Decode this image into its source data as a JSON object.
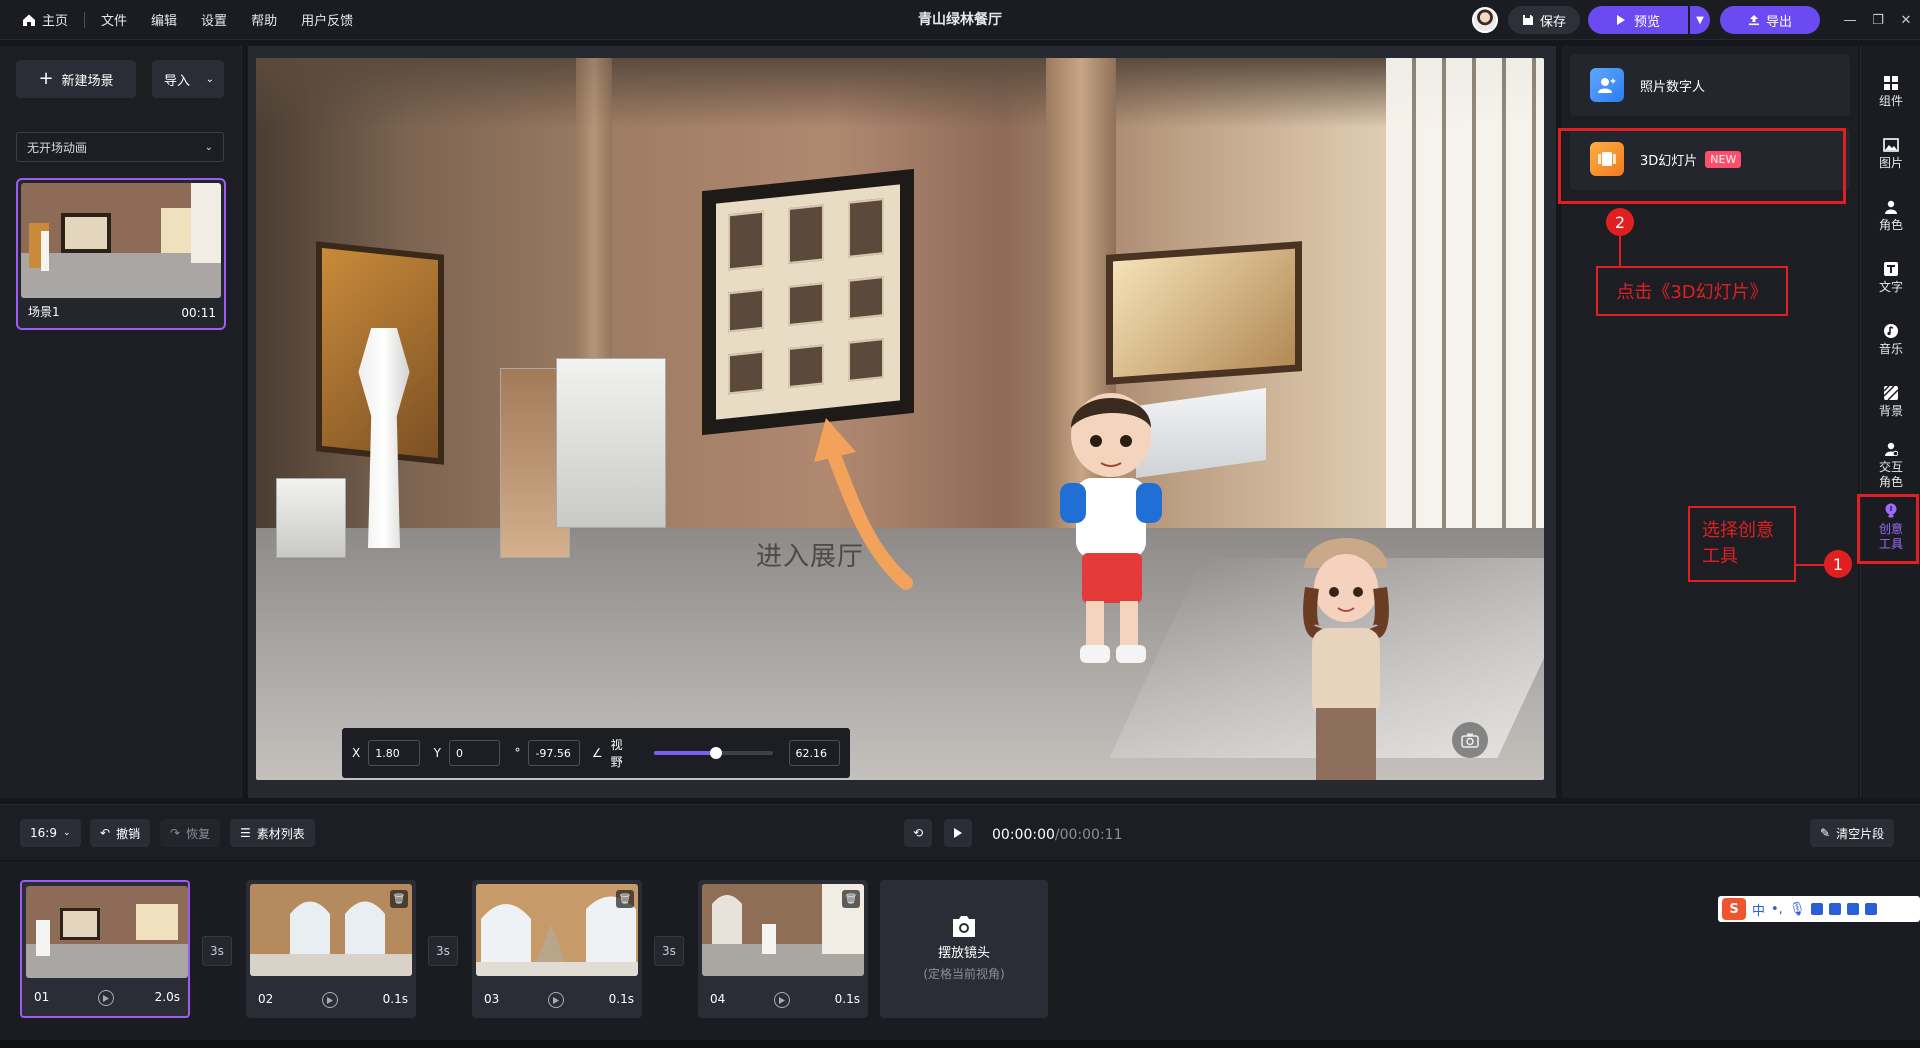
{
  "topbar": {
    "menu": [
      "主页",
      "文件",
      "编辑",
      "设置",
      "帮助",
      "用户反馈"
    ],
    "title": "青山绿林餐厅",
    "save": "保存",
    "preview": "预览",
    "export": "导出"
  },
  "left": {
    "new_scene": "新建场景",
    "import": "导入",
    "transition": "无开场动画",
    "scene": {
      "name": "场景1",
      "duration": "00:11"
    }
  },
  "stage": {
    "caption": "进入展厅",
    "camera": {
      "x_label": "X",
      "x": "1.80",
      "y_label": "Y",
      "y": "0",
      "rot_label": "°",
      "rot": "-97.56",
      "fov_label": "视野",
      "fov": "62.16",
      "fov_level": 0.52
    }
  },
  "tools": {
    "photo_avatar": "照片数字人",
    "slides_3d": "3D幻灯片",
    "new_badge": "NEW"
  },
  "rail": [
    {
      "label": "组件",
      "icon": "grid-icon"
    },
    {
      "label": "图片",
      "icon": "image-icon"
    },
    {
      "label": "角色",
      "icon": "person-icon"
    },
    {
      "label": "文字",
      "icon": "text-icon"
    },
    {
      "label": "音乐",
      "icon": "music-icon"
    },
    {
      "label": "背景",
      "icon": "background-icon"
    },
    {
      "label": "交互角色",
      "icon": "interactive-person-icon"
    },
    {
      "label": "创意工具",
      "icon": "idea-icon"
    }
  ],
  "annotations": {
    "step1_num": "1",
    "step1_text": "选择创意工具",
    "step2_num": "2",
    "step2_text": "点击《3D幻灯片》",
    "color": "#e02020"
  },
  "toolbar": {
    "ratio": "16:9",
    "undo": "撤销",
    "redo": "恢复",
    "assets": "素材列表",
    "time_current": "00:00:00",
    "time_total": "/00:00:11",
    "clear": "清空片段"
  },
  "timeline": {
    "clips": [
      {
        "num": "01",
        "dur": "2.0s"
      },
      {
        "num": "02",
        "dur": "0.1s"
      },
      {
        "num": "03",
        "dur": "0.1s"
      },
      {
        "num": "04",
        "dur": "0.1s"
      }
    ],
    "transitions": [
      "3s",
      "3s",
      "3s"
    ],
    "add_camera": "摆放镜头",
    "add_camera_hint": "(定格当前视角)"
  },
  "ime": {
    "logo": "S",
    "lang": "中",
    "punct": "•,"
  },
  "colors": {
    "accent": "#6a4bf2",
    "selection": "#9d5cf2",
    "annotation": "#e02020"
  }
}
